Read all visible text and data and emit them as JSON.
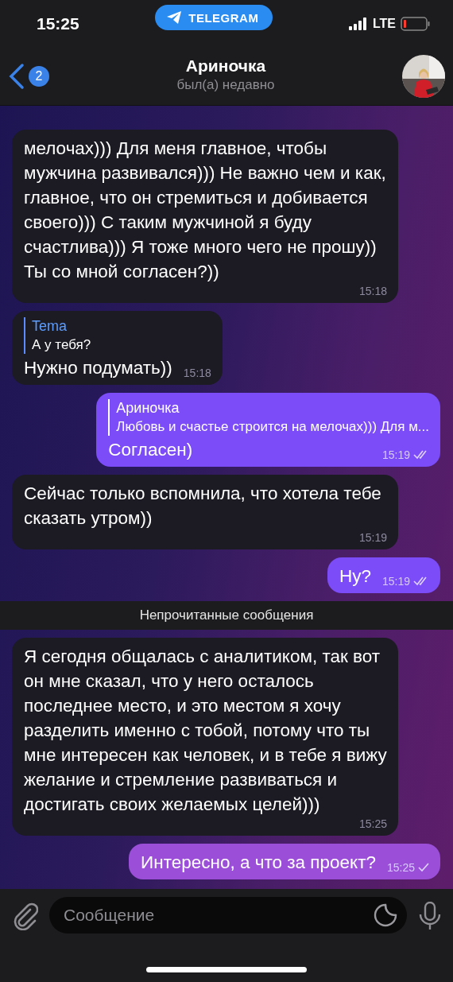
{
  "status_bar": {
    "time": "15:25",
    "app_pill": "TELEGRAM",
    "network": "LTE"
  },
  "header": {
    "back_badge": "2",
    "title": "Ариночка",
    "subtitle": "был(а) недавно"
  },
  "messages": [
    {
      "kind": "incoming",
      "text": "мелочах))) Для меня главное, чтобы мужчина развивался))) Не важно чем и как, главное, что он стремиться и добивается своего))) С таким мужчиной я буду счастлива))) Я тоже много чего не прошу))\nТы со мной согласен?))",
      "time": "15:18"
    },
    {
      "kind": "incoming",
      "reply": {
        "author": "Tema",
        "text": "А у тебя?"
      },
      "text": "Нужно подумать))",
      "time": "15:18"
    },
    {
      "kind": "outgoing",
      "reply": {
        "author": "Ариночка",
        "text": "Любовь и счастье строится на мелочах))) Для м..."
      },
      "text": "Согласен)",
      "time": "15:19",
      "read": true
    },
    {
      "kind": "incoming",
      "text": "Сейчас только вспомнила, что хотела тебе сказать утром))",
      "time": "15:19"
    },
    {
      "kind": "outgoing",
      "text": "Ну?",
      "time": "15:19",
      "read": true
    },
    {
      "kind": "divider",
      "text": "Непрочитанные сообщения"
    },
    {
      "kind": "incoming",
      "text": "Я сегодня общалась с аналитиком, так вот он мне сказал, что у него осталось последнее место, и это местом я хочу разделить именно с тобой, потому что ты мне интересен как человек, и в тебе я вижу желание и стремление развиваться и достигать своих желаемых целей)))",
      "time": "15:25"
    },
    {
      "kind": "outgoing",
      "text": "Интересно, а что за проект?",
      "time": "15:25",
      "read": false
    }
  ],
  "composer": {
    "placeholder": "Сообщение"
  }
}
